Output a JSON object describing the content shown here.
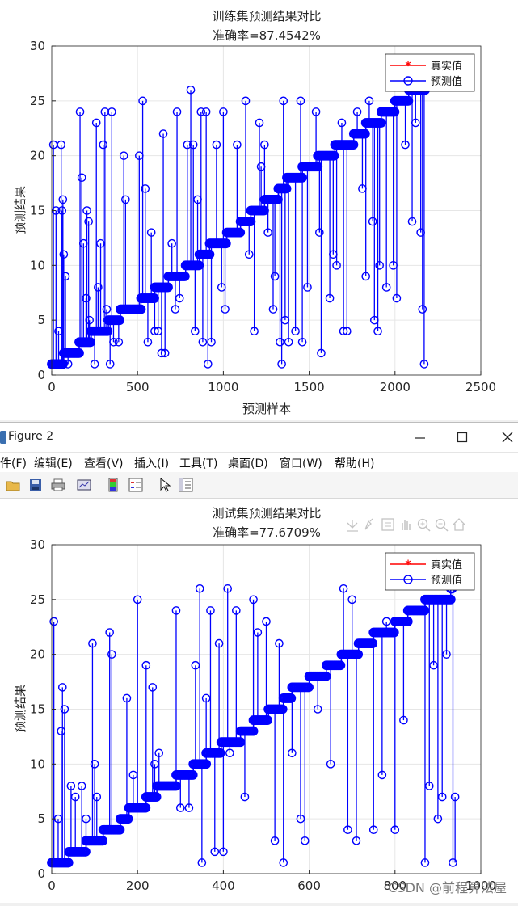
{
  "figure1": {
    "title_line1": "训练集预测结果对比",
    "title_line2": "准确率=87.4542%",
    "xlabel": "预测样本",
    "ylabel": "预测结果",
    "legend": [
      "真实值",
      "预测值"
    ]
  },
  "figure2": {
    "window_title": "Figure 2",
    "menu": [
      "件(F)",
      "编辑(E)",
      "查看(V)",
      "插入(I)",
      "工具(T)",
      "桌面(D)",
      "窗口(W)",
      "帮助(H)"
    ],
    "title_line1": "测试集预测结果对比",
    "title_line2": "准确率=77.6709%",
    "ylabel": "预测结果",
    "legend": [
      "真实值",
      "预测值"
    ]
  },
  "watermark": "CSDN @前程算法屋",
  "colors": {
    "true_series": "#ff0000",
    "pred_series": "#0000ff",
    "axes": "#262626",
    "grid": "#e6e6e6"
  },
  "chart_data": [
    {
      "type": "line",
      "title": "训练集预测结果对比\n准确率=87.4542%",
      "xlabel": "预测样本",
      "ylabel": "预测结果",
      "xlim": [
        0,
        2500
      ],
      "ylim": [
        0,
        30
      ],
      "xticks": [
        0,
        500,
        1000,
        1500,
        2000,
        2500
      ],
      "yticks": [
        0,
        5,
        10,
        15,
        20,
        25,
        30
      ],
      "grid": true,
      "legend_position": "top-right",
      "series": [
        {
          "name": "真实值",
          "color": "#ff0000",
          "marker": "*",
          "steps": [
            [
              1,
              0,
              70
            ],
            [
              2,
              70,
              160
            ],
            [
              3,
              160,
              230
            ],
            [
              4,
              230,
              330
            ],
            [
              5,
              330,
              400
            ],
            [
              6,
              400,
              520
            ],
            [
              7,
              520,
              600
            ],
            [
              8,
              600,
              680
            ],
            [
              9,
              680,
              780
            ],
            [
              10,
              780,
              860
            ],
            [
              11,
              860,
              920
            ],
            [
              12,
              920,
              1020
            ],
            [
              13,
              1020,
              1100
            ],
            [
              14,
              1100,
              1160
            ],
            [
              15,
              1160,
              1240
            ],
            [
              16,
              1240,
              1320
            ],
            [
              17,
              1320,
              1370
            ],
            [
              18,
              1370,
              1460
            ],
            [
              19,
              1460,
              1550
            ],
            [
              20,
              1550,
              1650
            ],
            [
              21,
              1650,
              1760
            ],
            [
              22,
              1760,
              1830
            ],
            [
              23,
              1830,
              1920
            ],
            [
              24,
              1920,
              2000
            ],
            [
              25,
              2000,
              2080
            ],
            [
              26,
              2080,
              2176
            ]
          ]
        },
        {
          "name": "预测值",
          "color": "#0000ff",
          "marker": "o",
          "outliers": [
            [
              10,
              21
            ],
            [
              25,
              15
            ],
            [
              40,
              4
            ],
            [
              55,
              21
            ],
            [
              60,
              15
            ],
            [
              65,
              16
            ],
            [
              70,
              11
            ],
            [
              80,
              9
            ],
            [
              95,
              1
            ],
            [
              165,
              24
            ],
            [
              175,
              18
            ],
            [
              185,
              12
            ],
            [
              200,
              7
            ],
            [
              205,
              15
            ],
            [
              215,
              14
            ],
            [
              220,
              5
            ],
            [
              250,
              1
            ],
            [
              260,
              23
            ],
            [
              270,
              8
            ],
            [
              285,
              12
            ],
            [
              300,
              21
            ],
            [
              310,
              24
            ],
            [
              320,
              6
            ],
            [
              340,
              1
            ],
            [
              350,
              24
            ],
            [
              360,
              3
            ],
            [
              390,
              3
            ],
            [
              420,
              20
            ],
            [
              430,
              16
            ],
            [
              510,
              20
            ],
            [
              530,
              25
            ],
            [
              545,
              17
            ],
            [
              560,
              3
            ],
            [
              580,
              13
            ],
            [
              600,
              4
            ],
            [
              620,
              4
            ],
            [
              640,
              2
            ],
            [
              650,
              22
            ],
            [
              660,
              2
            ],
            [
              700,
              12
            ],
            [
              720,
              6
            ],
            [
              730,
              24
            ],
            [
              745,
              7
            ],
            [
              790,
              21
            ],
            [
              810,
              26
            ],
            [
              825,
              21
            ],
            [
              835,
              4
            ],
            [
              850,
              16
            ],
            [
              870,
              24
            ],
            [
              880,
              3
            ],
            [
              900,
              24
            ],
            [
              910,
              1
            ],
            [
              930,
              3
            ],
            [
              960,
              21
            ],
            [
              990,
              8
            ],
            [
              1000,
              24
            ],
            [
              1010,
              6
            ],
            [
              1080,
              21
            ],
            [
              1130,
              25
            ],
            [
              1150,
              11
            ],
            [
              1180,
              4
            ],
            [
              1210,
              23
            ],
            [
              1220,
              19
            ],
            [
              1240,
              21
            ],
            [
              1260,
              13
            ],
            [
              1290,
              6
            ],
            [
              1300,
              9
            ],
            [
              1330,
              3
            ],
            [
              1340,
              1
            ],
            [
              1350,
              25
            ],
            [
              1360,
              5
            ],
            [
              1380,
              3
            ],
            [
              1420,
              4
            ],
            [
              1450,
              25
            ],
            [
              1460,
              3
            ],
            [
              1490,
              8
            ],
            [
              1540,
              24
            ],
            [
              1560,
              13
            ],
            [
              1570,
              2
            ],
            [
              1620,
              7
            ],
            [
              1640,
              11
            ],
            [
              1660,
              10
            ],
            [
              1690,
              23
            ],
            [
              1700,
              4
            ],
            [
              1720,
              4
            ],
            [
              1740,
              21
            ],
            [
              1780,
              24
            ],
            [
              1810,
              17
            ],
            [
              1830,
              9
            ],
            [
              1850,
              25
            ],
            [
              1870,
              14
            ],
            [
              1880,
              5
            ],
            [
              1900,
              4
            ],
            [
              1910,
              10
            ],
            [
              1950,
              8
            ],
            [
              1990,
              10
            ],
            [
              2010,
              7
            ],
            [
              2060,
              21
            ],
            [
              2100,
              14
            ],
            [
              2120,
              23
            ],
            [
              2150,
              13
            ],
            [
              2160,
              6
            ],
            [
              2170,
              1
            ]
          ]
        }
      ]
    },
    {
      "type": "line",
      "title": "测试集预测结果对比\n准确率=77.6709%",
      "xlabel": "",
      "ylabel": "预测结果",
      "xlim": [
        0,
        1000
      ],
      "ylim": [
        0,
        30
      ],
      "xticks": [
        0,
        200,
        400,
        600,
        800,
        1000
      ],
      "yticks": [
        0,
        5,
        10,
        15,
        20,
        25,
        30
      ],
      "grid": true,
      "legend_position": "top-right",
      "series": [
        {
          "name": "真实值",
          "color": "#ff0000",
          "marker": "*",
          "steps": [
            [
              1,
              0,
              40
            ],
            [
              2,
              40,
              80
            ],
            [
              3,
              80,
              120
            ],
            [
              4,
              120,
              160
            ],
            [
              5,
              160,
              180
            ],
            [
              6,
              180,
              220
            ],
            [
              7,
              220,
              245
            ],
            [
              8,
              245,
              290
            ],
            [
              9,
              290,
              330
            ],
            [
              10,
              330,
              360
            ],
            [
              11,
              360,
              395
            ],
            [
              12,
              395,
              440
            ],
            [
              13,
              440,
              470
            ],
            [
              14,
              470,
              505
            ],
            [
              15,
              505,
              540
            ],
            [
              16,
              540,
              560
            ],
            [
              17,
              560,
              600
            ],
            [
              18,
              600,
              640
            ],
            [
              19,
              640,
              675
            ],
            [
              20,
              675,
              715
            ],
            [
              21,
              715,
              750
            ],
            [
              22,
              750,
              800
            ],
            [
              23,
              800,
              830
            ],
            [
              24,
              830,
              870
            ],
            [
              25,
              870,
              930
            ],
            [
              26,
              930,
              935
            ]
          ]
        },
        {
          "name": "预测值",
          "color": "#0000ff",
          "marker": "o",
          "outliers": [
            [
              5,
              23
            ],
            [
              15,
              5
            ],
            [
              22,
              13
            ],
            [
              25,
              17
            ],
            [
              30,
              15
            ],
            [
              45,
              8
            ],
            [
              55,
              7
            ],
            [
              70,
              8
            ],
            [
              80,
              5
            ],
            [
              95,
              21
            ],
            [
              100,
              10
            ],
            [
              105,
              7
            ],
            [
              135,
              22
            ],
            [
              140,
              20
            ],
            [
              155,
              4
            ],
            [
              175,
              16
            ],
            [
              190,
              9
            ],
            [
              200,
              25
            ],
            [
              220,
              19
            ],
            [
              235,
              17
            ],
            [
              240,
              10
            ],
            [
              250,
              11
            ],
            [
              290,
              24
            ],
            [
              300,
              6
            ],
            [
              320,
              6
            ],
            [
              335,
              19
            ],
            [
              345,
              26
            ],
            [
              350,
              1
            ],
            [
              360,
              16
            ],
            [
              370,
              24
            ],
            [
              380,
              2
            ],
            [
              390,
              21
            ],
            [
              400,
              2
            ],
            [
              410,
              26
            ],
            [
              415,
              11
            ],
            [
              430,
              24
            ],
            [
              450,
              7
            ],
            [
              470,
              25
            ],
            [
              480,
              22
            ],
            [
              500,
              23
            ],
            [
              520,
              3
            ],
            [
              530,
              21
            ],
            [
              540,
              1
            ],
            [
              560,
              11
            ],
            [
              580,
              5
            ],
            [
              590,
              3
            ],
            [
              620,
              15
            ],
            [
              650,
              10
            ],
            [
              680,
              26
            ],
            [
              690,
              4
            ],
            [
              700,
              25
            ],
            [
              710,
              3
            ],
            [
              750,
              4
            ],
            [
              770,
              9
            ],
            [
              780,
              23
            ],
            [
              800,
              4
            ],
            [
              820,
              14
            ],
            [
              860,
              24
            ],
            [
              870,
              1
            ],
            [
              880,
              8
            ],
            [
              890,
              19
            ],
            [
              900,
              5
            ],
            [
              910,
              7
            ],
            [
              920,
              20
            ],
            [
              935,
              1
            ],
            [
              940,
              7
            ]
          ]
        }
      ]
    }
  ]
}
